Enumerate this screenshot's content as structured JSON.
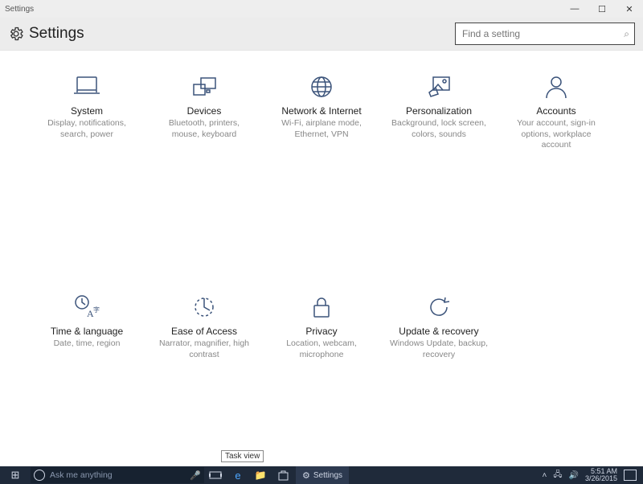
{
  "window": {
    "app_name": "Settings",
    "title": "Settings"
  },
  "search": {
    "placeholder": "Find a setting"
  },
  "tiles": [
    {
      "name": "System",
      "desc": "Display, notifications, search, power"
    },
    {
      "name": "Devices",
      "desc": "Bluetooth, printers, mouse, keyboard"
    },
    {
      "name": "Network & Internet",
      "desc": "Wi-Fi, airplane mode, Ethernet, VPN"
    },
    {
      "name": "Personalization",
      "desc": "Background, lock screen, colors, sounds"
    },
    {
      "name": "Accounts",
      "desc": "Your account, sign-in options, workplace account"
    },
    {
      "name": "Time & language",
      "desc": "Date, time, region"
    },
    {
      "name": "Ease of Access",
      "desc": "Narrator, magnifier, high contrast"
    },
    {
      "name": "Privacy",
      "desc": "Location, webcam, microphone"
    },
    {
      "name": "Update & recovery",
      "desc": "Windows Update, backup, recovery"
    }
  ],
  "tooltip": "Task view",
  "taskbar": {
    "cortana_placeholder": "Ask me anything",
    "active_app": "Settings",
    "time": "5:51 AM",
    "date": "3/26/2015"
  }
}
